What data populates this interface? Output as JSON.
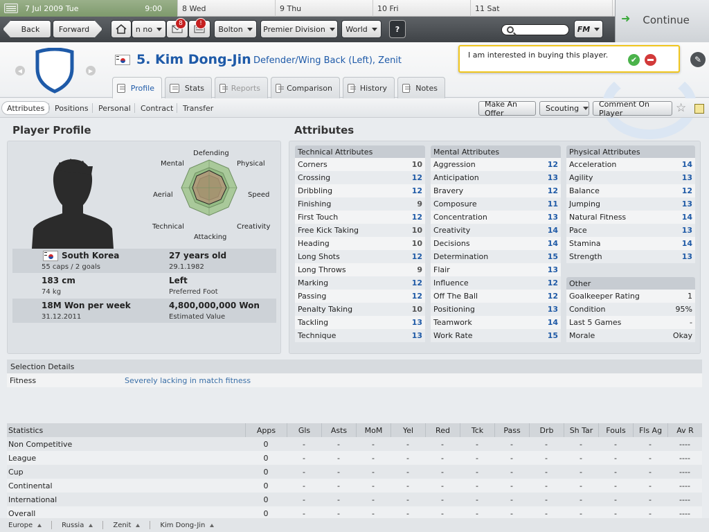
{
  "calendar": {
    "today_date": "7 Jul 2009  Tue",
    "time": "9:00",
    "days": [
      "8  Wed",
      "9  Thu",
      "10  Fri",
      "11  Sat"
    ]
  },
  "toolbar": {
    "back": "Back",
    "forward": "Forward",
    "home_menu": "n no",
    "inbox_badge": "8",
    "alert_badge": "!",
    "club_menu": "Bolton",
    "division_menu": "Premier Division",
    "world_menu": "World",
    "help": "?",
    "fm_menu": "FM",
    "continue": "Continue"
  },
  "player": {
    "name": "5. Kim Dong-Jin",
    "position": "Defender/Wing Back (Left), Zenit"
  },
  "notice": {
    "text": "I am interested in buying this player."
  },
  "tabs": [
    "Profile",
    "Stats",
    "Reports",
    "Comparison",
    "History",
    "Notes"
  ],
  "subtabs": [
    "Attributes",
    "Positions",
    "Personal",
    "Contract",
    "Transfer"
  ],
  "actions": {
    "make_offer": "Make An Offer",
    "scouting": "Scouting",
    "comment": "Comment On Player"
  },
  "profile": {
    "title": "Player Profile",
    "radar_labels": {
      "defending": "Defending",
      "physical": "Physical",
      "speed": "Speed",
      "creativity": "Creativity",
      "attacking": "Attacking",
      "technical": "Technical",
      "aerial": "Aerial",
      "mental": "Mental"
    },
    "nation": "South Korea",
    "caps": "55 caps / 2 goals",
    "age": "27 years old",
    "dob": "29.1.1982",
    "height": "183 cm",
    "weight": "74 kg",
    "foot": "Left",
    "foot_label": "Preferred Foot",
    "wage": "18M Won per week",
    "contract_end": "31.12.2011",
    "value": "4,800,000,000 Won",
    "value_label": "Estimated Value"
  },
  "attributes": {
    "title": "Attributes",
    "technical": {
      "heading": "Technical Attributes",
      "items": [
        {
          "name": "Corners",
          "value": "10"
        },
        {
          "name": "Crossing",
          "value": "12"
        },
        {
          "name": "Dribbling",
          "value": "12"
        },
        {
          "name": "Finishing",
          "value": "9"
        },
        {
          "name": "First Touch",
          "value": "12"
        },
        {
          "name": "Free Kick Taking",
          "value": "10"
        },
        {
          "name": "Heading",
          "value": "10"
        },
        {
          "name": "Long Shots",
          "value": "12"
        },
        {
          "name": "Long Throws",
          "value": "9"
        },
        {
          "name": "Marking",
          "value": "12"
        },
        {
          "name": "Passing",
          "value": "12"
        },
        {
          "name": "Penalty Taking",
          "value": "10"
        },
        {
          "name": "Tackling",
          "value": "13"
        },
        {
          "name": "Technique",
          "value": "13"
        }
      ]
    },
    "mental": {
      "heading": "Mental Attributes",
      "items": [
        {
          "name": "Aggression",
          "value": "12"
        },
        {
          "name": "Anticipation",
          "value": "13"
        },
        {
          "name": "Bravery",
          "value": "12"
        },
        {
          "name": "Composure",
          "value": "11"
        },
        {
          "name": "Concentration",
          "value": "13"
        },
        {
          "name": "Creativity",
          "value": "14"
        },
        {
          "name": "Decisions",
          "value": "14"
        },
        {
          "name": "Determination",
          "value": "15"
        },
        {
          "name": "Flair",
          "value": "13"
        },
        {
          "name": "Influence",
          "value": "12"
        },
        {
          "name": "Off The Ball",
          "value": "12"
        },
        {
          "name": "Positioning",
          "value": "13"
        },
        {
          "name": "Teamwork",
          "value": "14"
        },
        {
          "name": "Work Rate",
          "value": "15"
        }
      ]
    },
    "physical": {
      "heading": "Physical Attributes",
      "items": [
        {
          "name": "Acceleration",
          "value": "14"
        },
        {
          "name": "Agility",
          "value": "13"
        },
        {
          "name": "Balance",
          "value": "12"
        },
        {
          "name": "Jumping",
          "value": "13"
        },
        {
          "name": "Natural Fitness",
          "value": "14"
        },
        {
          "name": "Pace",
          "value": "13"
        },
        {
          "name": "Stamina",
          "value": "14"
        },
        {
          "name": "Strength",
          "value": "13"
        }
      ]
    },
    "other": {
      "heading": "Other",
      "items": [
        {
          "name": "Goalkeeper Rating",
          "value": "1"
        },
        {
          "name": "Condition",
          "value": "95%"
        },
        {
          "name": "Last 5 Games",
          "value": "-"
        },
        {
          "name": "Morale",
          "value": "Okay"
        }
      ]
    }
  },
  "selection": {
    "heading": "Selection Details",
    "fitness_label": "Fitness",
    "fitness_value": "Severely lacking in match fitness"
  },
  "statistics": {
    "columns": [
      "Statistics",
      "Apps",
      "Gls",
      "Asts",
      "MoM",
      "Yel",
      "Red",
      "Tck",
      "Pass",
      "Drb",
      "Sh Tar",
      "Fouls",
      "Fls Ag",
      "Av R"
    ],
    "rows": [
      [
        "Non Competitive",
        "0",
        "-",
        "-",
        "-",
        "-",
        "-",
        "-",
        "-",
        "-",
        "-",
        "-",
        "-",
        "----"
      ],
      [
        "League",
        "0",
        "-",
        "-",
        "-",
        "-",
        "-",
        "-",
        "-",
        "-",
        "-",
        "-",
        "-",
        "----"
      ],
      [
        "Cup",
        "0",
        "-",
        "-",
        "-",
        "-",
        "-",
        "-",
        "-",
        "-",
        "-",
        "-",
        "-",
        "----"
      ],
      [
        "Continental",
        "0",
        "-",
        "-",
        "-",
        "-",
        "-",
        "-",
        "-",
        "-",
        "-",
        "-",
        "-",
        "----"
      ],
      [
        "International",
        "0",
        "-",
        "-",
        "-",
        "-",
        "-",
        "-",
        "-",
        "-",
        "-",
        "-",
        "-",
        "----"
      ],
      [
        "Overall",
        "0",
        "-",
        "-",
        "-",
        "-",
        "-",
        "-",
        "-",
        "-",
        "-",
        "-",
        "-",
        "----"
      ]
    ]
  },
  "breadcrumbs": [
    "Europe",
    "Russia",
    "Zenit",
    "Kim Dong-Jin"
  ]
}
